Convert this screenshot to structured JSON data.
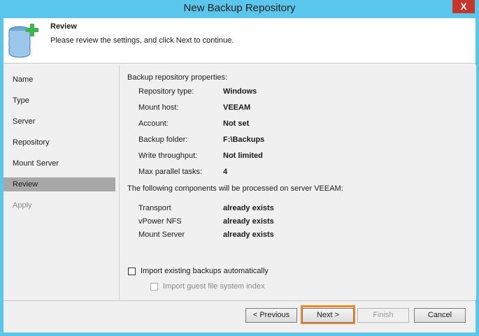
{
  "window": {
    "title": "New Backup Repository",
    "close_glyph": "X"
  },
  "header": {
    "title": "Review",
    "subtitle": "Please review the settings, and click Next to continue.",
    "icon": "database-add-icon"
  },
  "sidebar": {
    "items": [
      {
        "label": "Name"
      },
      {
        "label": "Type"
      },
      {
        "label": "Server"
      },
      {
        "label": "Repository"
      },
      {
        "label": "Mount Server"
      },
      {
        "label": "Review"
      },
      {
        "label": "Apply"
      }
    ],
    "active": "Review"
  },
  "content": {
    "props_heading": "Backup repository properties:",
    "properties": [
      {
        "label": "Repository type:",
        "value": "Windows"
      },
      {
        "label": "Mount host:",
        "value": "VEEAM"
      },
      {
        "label": "Account:",
        "value": "Not set"
      },
      {
        "label": "Backup folder:",
        "value": "F:\\Backups"
      },
      {
        "label": "Write throughput:",
        "value": "Not limited"
      },
      {
        "label": "Max parallel tasks:",
        "value": "4"
      }
    ],
    "components_heading": "The following components will be processed on server VEEAM:",
    "components": [
      {
        "label": "Transport",
        "value": "already exists"
      },
      {
        "label": "vPower NFS",
        "value": "already exists"
      },
      {
        "label": "Mount Server",
        "value": "already exists"
      }
    ],
    "import_backups_label": "Import existing backups automatically",
    "import_guest_label": "Import guest file system index"
  },
  "buttons": {
    "previous": "< Previous",
    "next": "Next >",
    "finish": "Finish",
    "cancel": "Cancel"
  },
  "colors": {
    "accent_highlight": "#f08a24",
    "window_frame": "#5bc6eb",
    "close_button": "#c7362a"
  }
}
